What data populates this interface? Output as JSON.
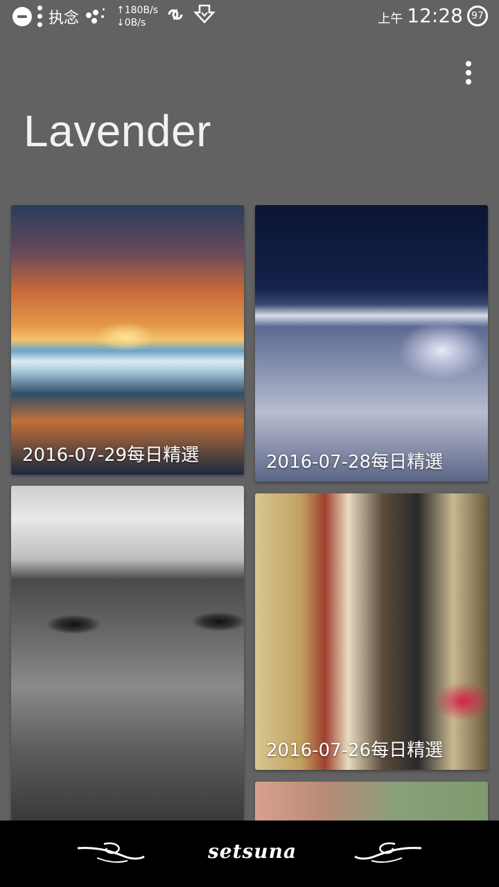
{
  "status_bar": {
    "app_label": "执念",
    "upload_speed": "↑180B/s",
    "download_speed": "↓0B/s",
    "ampm": "上午",
    "time": "12:28",
    "battery": "97",
    "icons": [
      "do-not-disturb-icon",
      "notification-dots-icon",
      "cluster-icon",
      "sync-icon",
      "download-icon"
    ]
  },
  "header": {
    "title": "Lavender",
    "menu_icon": "more-vert-icon"
  },
  "cards": [
    {
      "caption": "2016-07-29每日精選"
    },
    {
      "caption": "2016-07-28每日精選"
    },
    {
      "caption": ""
    },
    {
      "caption": "2016-07-26每日精選"
    },
    {
      "caption": ""
    }
  ],
  "bottom_nav": {
    "brand": "setsuna",
    "left_icon": "flourish-left-icon",
    "right_icon": "flourish-right-icon"
  },
  "colors": {
    "background": "#626262",
    "bottom_bar": "#000000",
    "text": "#ffffff"
  }
}
